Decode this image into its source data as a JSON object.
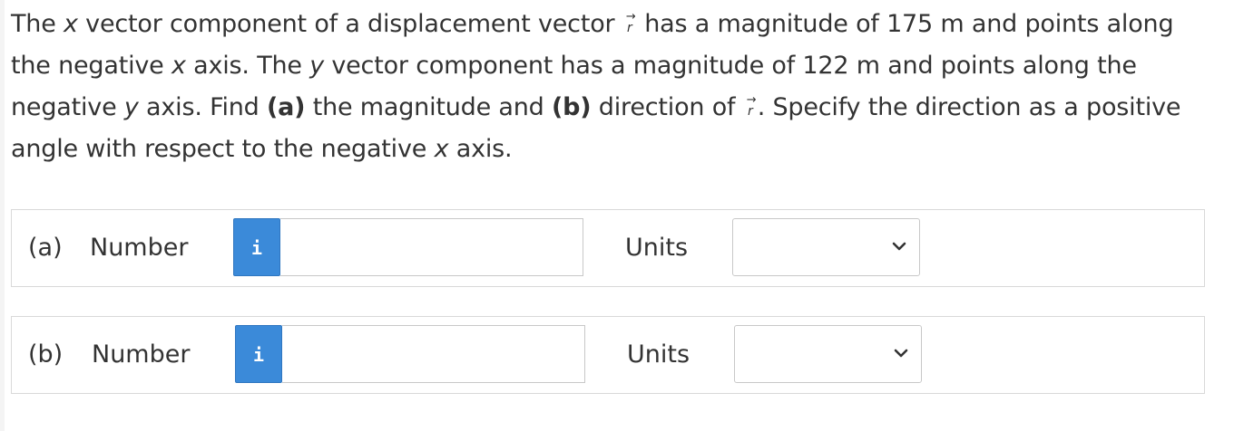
{
  "question": {
    "line1_pre": "The ",
    "line1_var_x": "x",
    "line1_mid": " vector component of a displacement vector ",
    "vector_symbol": "r",
    "vector_arrow": "→",
    "line1_post": " has a magnitude of 175 m and points along",
    "line2_pre": "the negative ",
    "line2_var_x": "x",
    "line2_mid": " axis. The ",
    "line2_var_y": "y",
    "line2_post": " vector component has a magnitude of 122 m and points along the",
    "line3_pre": "negative ",
    "line3_var_y": "y",
    "line3_mid1": " axis. Find ",
    "line3_bold_a": "(a)",
    "line3_mid2": " the magnitude and ",
    "line3_bold_b": "(b)",
    "line3_mid3": " direction of ",
    "line3_post": ". Specify the direction as a positive",
    "line4_pre": "angle with respect to the negative ",
    "line4_var_x": "x",
    "line4_post": " axis."
  },
  "rows": [
    {
      "part_label": "(a)",
      "number_label": "Number",
      "info_label": "i",
      "number_value": "",
      "units_label": "Units",
      "units_value": ""
    },
    {
      "part_label": "(b)",
      "number_label": "Number",
      "info_label": "i",
      "number_value": "",
      "units_label": "Units",
      "units_value": ""
    }
  ],
  "colors": {
    "info_button": "#3b8ad9",
    "text": "#333333",
    "border": "#d9d9d9"
  }
}
